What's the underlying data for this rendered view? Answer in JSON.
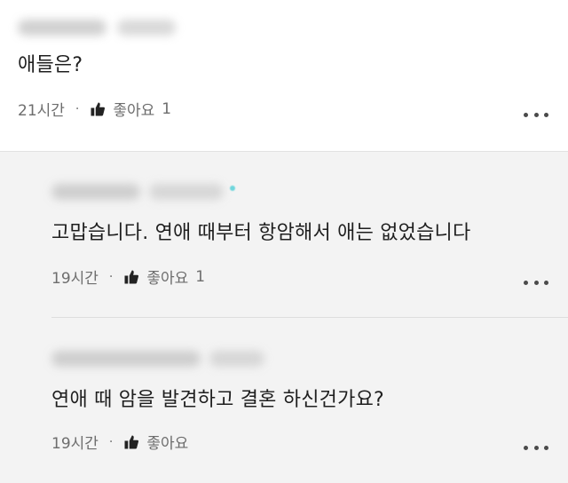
{
  "comment": {
    "text": "애들은?",
    "time": "21시간",
    "separator": "·",
    "like_label": "좋아요",
    "like_count": "1"
  },
  "replies": [
    {
      "text": "고맙습니다. 연애 때부터 항암해서 애는 없었습니다",
      "time": "19시간",
      "separator": "·",
      "like_label": "좋아요",
      "like_count": "1"
    },
    {
      "text": "연애 때 암을 발견하고 결혼 하신건가요?",
      "time": "19시간",
      "separator": "·",
      "like_label": "좋아요",
      "like_count": ""
    }
  ],
  "icons": {
    "like": "thumbs-up-icon",
    "more": "more-options-icon"
  },
  "colors": {
    "reply_background": "#f3f3f3",
    "meta_text": "#6d6d6d",
    "badge": "#6fd6dc"
  }
}
